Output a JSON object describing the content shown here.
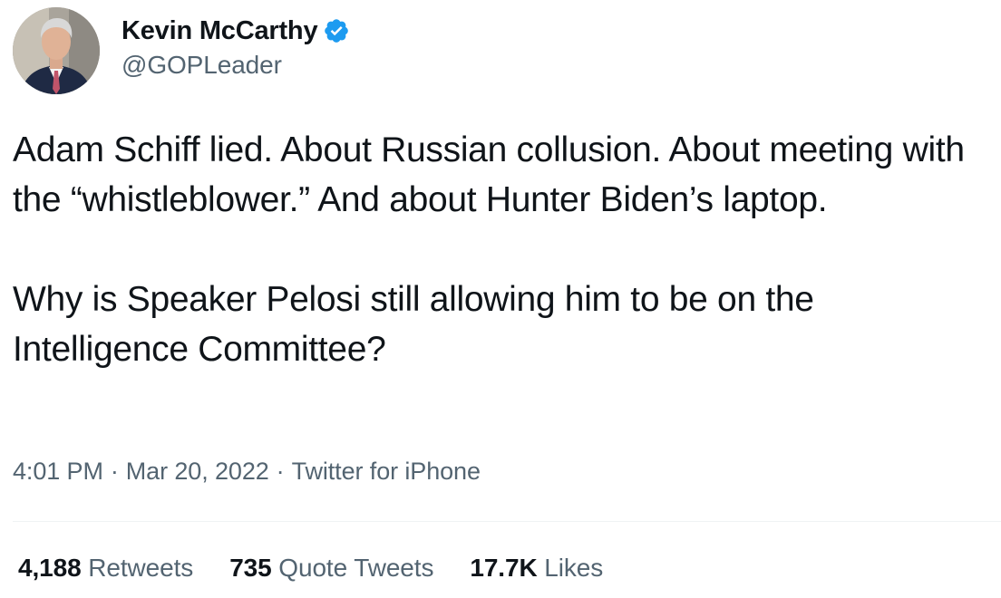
{
  "author": {
    "display_name": "Kevin McCarthy",
    "handle": "@GOPLeader",
    "verified": true,
    "avatar_icon": "profile-photo",
    "verified_color": "#1d9bf0"
  },
  "tweet": {
    "paragraphs": [
      "Adam Schiff lied. About Russian collusion. About meeting with the “whistleblower.” And about Hunter Biden’s laptop.",
      "Why is Speaker Pelosi still allowing him to be on the Intelligence Committee?"
    ]
  },
  "meta": {
    "time": "4:01 PM",
    "separator": "·",
    "date": "Mar 20, 2022",
    "source": "Twitter for iPhone"
  },
  "stats": {
    "retweets": {
      "count": "4,188",
      "label": "Retweets"
    },
    "quote_tweets": {
      "count": "735",
      "label": "Quote Tweets"
    },
    "likes": {
      "count": "17.7K",
      "label": "Likes"
    }
  },
  "colors": {
    "text_primary": "#0f1419",
    "text_secondary": "#536471",
    "divider": "#eff3f4"
  }
}
